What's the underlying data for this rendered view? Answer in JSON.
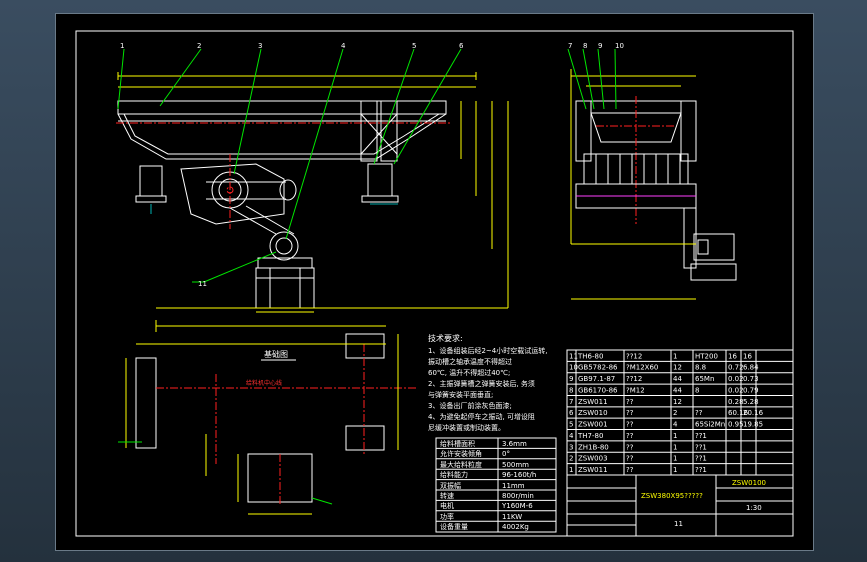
{
  "drawing": {
    "callouts": [
      "1",
      "2",
      "3",
      "4",
      "5",
      "6",
      "7",
      "8",
      "9",
      "10",
      "11"
    ],
    "foundation_title": "基础图",
    "foundation_center_label": "给料机中心线"
  },
  "tech_requirements": {
    "title": "技术要求:",
    "lines": [
      "1、设备组装后经2~4小时空载试运转,",
      "振动槽之轴承温度不得超过",
      "60℃, 温升不得超过40℃;",
      "2、主振弹簧槽之弹簧安装后, 务须",
      "与弹簧安装平面垂直;",
      "3、设备出厂前涂灰色面漆;",
      "4、为避免起停车之振动, 可增设阻",
      "尼缓冲装置或制动装置。"
    ]
  },
  "spec_table": {
    "rows": [
      {
        "label": "给料槽面积",
        "value": "3.6mm"
      },
      {
        "label": "允许安装倾角",
        "value": "0°"
      },
      {
        "label": "最大给料粒度",
        "value": "500mm"
      },
      {
        "label": "给料能力",
        "value": "96-160t/h"
      },
      {
        "label": "双振幅",
        "value": "11mm"
      },
      {
        "label": "转速",
        "value": "800r/min"
      },
      {
        "label": "电机",
        "value": "Y160M-6"
      },
      {
        "label": "功率",
        "value": "11KW"
      },
      {
        "label": "设备重量",
        "value": "4002Kg"
      }
    ]
  },
  "parts_list": {
    "rows": [
      [
        "11",
        "TH6-80",
        "??12",
        "1",
        "HT200",
        "16",
        "16"
      ],
      [
        "10",
        "GB5782-86",
        "?M12X60",
        "12",
        "8.8",
        "0.72",
        "6.84"
      ],
      [
        "9",
        "GB97.1-87",
        "??12",
        "44",
        "65Mn",
        "0.02",
        "0.73"
      ],
      [
        "8",
        "GB6170-86",
        "?M12",
        "44",
        "8",
        "0.02",
        "0.79"
      ],
      [
        "7",
        "ZSW011",
        "??",
        "12",
        "",
        "0.28",
        "5.28"
      ],
      [
        "6",
        "ZSW010",
        "??",
        "2",
        "??",
        "60.16",
        "20.16"
      ],
      [
        "5",
        "ZSW001",
        "??",
        "4",
        "65Si2Mn",
        "0.95",
        "19.85"
      ],
      [
        "4",
        "TH7-80",
        "??",
        "1",
        "??1",
        "",
        ""
      ],
      [
        "3",
        "ZH1B-80",
        "??",
        "1",
        "??1",
        "",
        ""
      ],
      [
        "2",
        "ZSW003",
        "??",
        "1",
        "??1",
        "",
        ""
      ],
      [
        "1",
        "ZSW011",
        "??",
        "1",
        "??1",
        "",
        ""
      ]
    ]
  },
  "title_block": {
    "model": "ZSW380X95?????",
    "drawing_no": "ZSW0100",
    "scale": "1:30",
    "sheet_label": "11"
  }
}
